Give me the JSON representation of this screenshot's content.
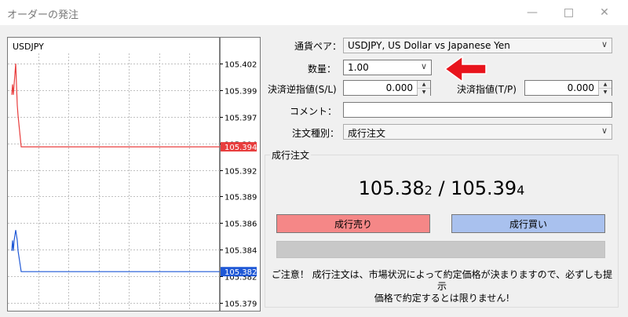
{
  "window": {
    "title": "オーダーの発注",
    "min_icon": "minimize-icon",
    "max_icon": "maximize-icon",
    "close_icon": "close-icon"
  },
  "chart": {
    "symbol": "USDJPY",
    "y_ticks": [
      "105.402",
      "105.399",
      "105.397",
      "105.394",
      "105.392",
      "105.389",
      "105.386",
      "105.384",
      "105.382",
      "105.379"
    ],
    "ask_label": "105.394",
    "bid_label": "105.382",
    "colors": {
      "ask": "#e83d3d",
      "bid": "#1f58d6",
      "grid": "#c0c0c0"
    }
  },
  "chart_data": {
    "type": "line",
    "title": "USDJPY",
    "ylim": [
      105.379,
      105.403
    ],
    "grid": true,
    "series": [
      {
        "name": "",
        "color": "#e83d3d",
        "values": [
          105.399,
          105.4,
          105.399,
          105.4,
          105.402,
          105.398,
          105.397,
          105.394,
          105.394,
          105.394,
          105.394,
          105.394
        ]
      },
      {
        "name": "",
        "color": "#1f58d6",
        "values": [
          105.384,
          105.385,
          105.384,
          105.385,
          105.386,
          105.385,
          105.384,
          105.382,
          105.382,
          105.382,
          105.382,
          105.382
        ]
      }
    ],
    "markers": {
      "ask": 105.394,
      "bid": 105.382
    }
  },
  "form": {
    "pair_label": "通貨ペア：",
    "pair_value": "USDJPY, US Dollar vs Japanese Yen",
    "volume_label": "数量：",
    "volume_value": "1.00",
    "sl_label": "決済逆指値(S/L)",
    "sl_value": "0.000",
    "tp_label": "決済指値(T/P)",
    "tp_value": "0.000",
    "comment_label": "コメント：",
    "comment_value": "",
    "type_label": "注文種別：",
    "type_value": "成行注文"
  },
  "market": {
    "group_label": "成行注文",
    "bid_main": "105.38",
    "bid_last": "2",
    "separator": " / ",
    "ask_main": "105.39",
    "ask_last": "4",
    "sell_label": "成行売り",
    "buy_label": "成行買い",
    "notice_line1": "ご注意！ 成行注文は、市場状況によって約定価格が決まりますので、必ずしも提示",
    "notice_line2": "価格で約定するとは限りません!"
  },
  "annotation": {
    "arrow_color": "#e8141c"
  }
}
